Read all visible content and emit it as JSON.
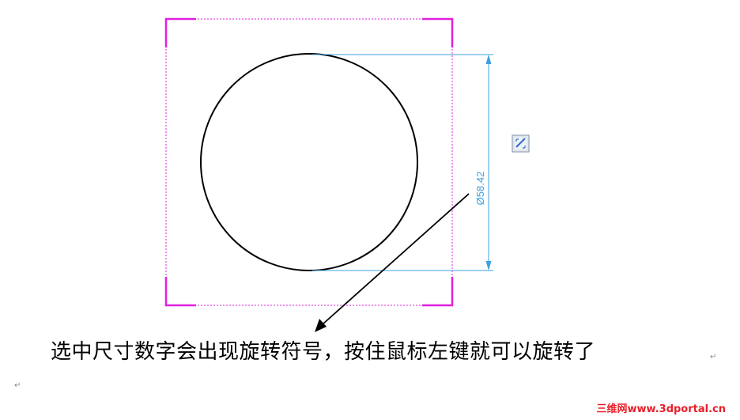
{
  "colors": {
    "sketch_box": "#e020e0",
    "circle": "#000000",
    "dimension": "#3ea0e0",
    "arrow": "#000000",
    "watermark": "#e8202a"
  },
  "dimension": {
    "text": "Ø58.42"
  },
  "rotate_handle": {
    "icon": "rotate-dimension-icon"
  },
  "caption": {
    "text": "选中尺寸数字会出现旋转符号，按住鼠标左键就可以旋转了"
  },
  "paragraph_mark": "↵",
  "watermark": "三维网www.3dportal.cn"
}
